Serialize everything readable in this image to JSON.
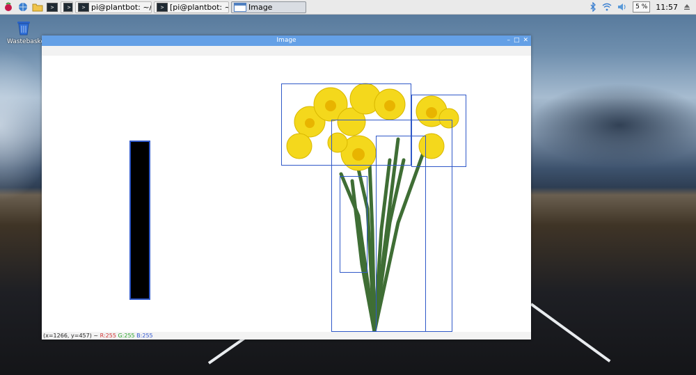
{
  "taskbar": {
    "tasks": [
      {
        "label": ""
      },
      {
        "label": "pi@plantbot: ~/plant..."
      },
      {
        "label": "[pi@plantbot: ~]"
      },
      {
        "label": "Image"
      }
    ],
    "cpu": "5 %",
    "clock": "11:57"
  },
  "desktop": {
    "wastebasket_label": "Wastebasket"
  },
  "window": {
    "title": "Image",
    "status": {
      "coords": "(x=1266, y=457) ~",
      "r": "R:255",
      "g": "G:255",
      "b": "B:255"
    }
  },
  "colors": {
    "titlebar": "#64a0e6",
    "bbox": "#2f58c8"
  }
}
